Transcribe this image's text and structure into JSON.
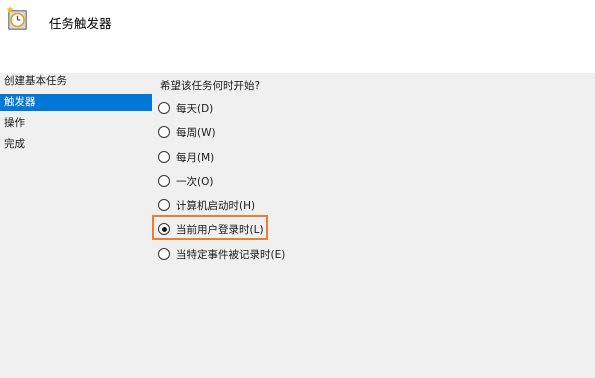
{
  "window": {
    "title": "任务触发器",
    "icon": "clock-task-icon"
  },
  "sidebar": {
    "items": [
      {
        "label": "创建基本任务",
        "selected": false
      },
      {
        "label": "触发器",
        "selected": true
      },
      {
        "label": "操作",
        "selected": false
      },
      {
        "label": "完成",
        "selected": false
      }
    ]
  },
  "main": {
    "question": "希望该任务何时开始?",
    "options": [
      {
        "label": "每天(D)",
        "checked": false
      },
      {
        "label": "每周(W)",
        "checked": false
      },
      {
        "label": "每月(M)",
        "checked": false
      },
      {
        "label": "一次(O)",
        "checked": false
      },
      {
        "label": "计算机启动时(H)",
        "checked": false
      },
      {
        "label": "当前用户登录时(L)",
        "checked": true
      },
      {
        "label": "当特定事件被记录时(E)",
        "checked": false
      }
    ]
  },
  "colors": {
    "selection": "#0078d7",
    "highlight_border": "#ed7d31",
    "header_bg": "#ffffff",
    "body_bg": "#f0f0f0"
  }
}
